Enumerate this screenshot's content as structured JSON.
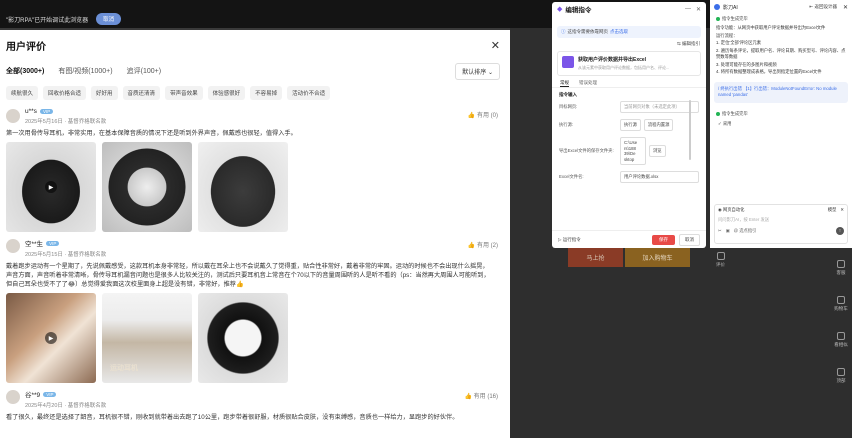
{
  "background": {
    "banner_text": "\"影刀RPA\"已开始调试此浏览器",
    "cancel_label": "取消",
    "add_cart": "加入购物车",
    "buy_now": "马上抢",
    "comment": "评价",
    "side_icons": [
      "客服",
      "购物车",
      "看相似",
      "顶部"
    ]
  },
  "reviews": {
    "title": "用户评价",
    "close_icon": "close-icon",
    "filters": [
      {
        "label": "全部(3000+)",
        "active": true
      },
      {
        "label": "有图/视频(1000+)",
        "active": false
      },
      {
        "label": "追评(100+)",
        "active": false
      }
    ],
    "sort_label": "默认排序 ⌄",
    "tags": [
      "续航很久",
      "回收价格合适",
      "好好用",
      "音质还清清",
      "带声音效果",
      "体验感很好",
      "不容易掉",
      "活动价不合适"
    ],
    "items": [
      {
        "name": "u**s",
        "vip": "VIP",
        "meta": "2025年5月16日 · 基督乔格联名款",
        "useful": "有用 (0)",
        "text": "第一次用骨传导耳机，非常实用，在基本保障音质的情况下还是听到外界声音，佩戴感也很轻，值得入手。"
      },
      {
        "name": "空**生",
        "vip": "VIP",
        "meta": "2025年5月15日 · 基督乔格联名款",
        "useful": "有用 (2)",
        "text": "戴着跑步运动有一个星期了，先说佩戴感受，这款耳机本身非常轻，所以戴在耳朵上也不会说戴久了觉得重，贴合性非常好，戴着非常的牢固。运动的时候也不会出现什么摇晃，声音方面，声音听着非常清晰，骨传导耳机漏音问题也是很多人比较关注的，测试后只要耳机音上常音在个70以下的音量周围听的人是听不看的（ps：当然再大周围人可能听到，但自己耳朵也受不了了😂）总觉得爱我面这次校里面身上超是没有错，非常好，推荐👍",
        "box_label": "运动耳机"
      },
      {
        "name": "谷**9",
        "vip": "VIP",
        "meta": "2025年4月20日 · 基督乔格联名款",
        "useful": "有用 (16)",
        "text": "看了很久，最终还是选择了韶音，耳机很不错，刚收到就带着出去跑了10公里，跑步带着很舒服，材质很贴合皮肤，没有束缚感，音质也一样给力，显跑步的好伙伴。"
      }
    ]
  },
  "edit_panel": {
    "title": "编辑指令",
    "tip_text": "这指令需要依靠网页",
    "tip_link": "点击选取",
    "edit_link": "编辑指引",
    "card_title": "获取用户评价数据并导出Excel",
    "card_sub": "从该元素中获取用户评论数据，包括用户名、评论...",
    "tabs": [
      "常规",
      "错误处理"
    ],
    "section": "指令输入",
    "rows": [
      {
        "label": "目标网页:",
        "value": "当前网页对象（未选定此项）"
      },
      {
        "label": "执行源:",
        "chip1": "执行源",
        "chip2": "流程内置源"
      },
      {
        "label": "导出Excel文件的保存文件夹:",
        "path": "C:\\Use rs\\188 39\\De sktop",
        "chip": "浏览"
      },
      {
        "label": "Excel文件名:",
        "value": "用户评论数据.xlsx"
      }
    ],
    "footer_run": "运行指令",
    "save": "保存",
    "cancel": "取消"
  },
  "ai_panel": {
    "title": "影刀AI",
    "back": "返回设计器",
    "status_done": "指令生成完毕",
    "msg": "指令功能：从网页中获取用户评论数据并导出为Excel文件",
    "steps_title": "运行流程：",
    "steps": [
      "1. 定位'全部'评论区元素",
      "2. 遍历每条评论，提取用户名、评论日期、购买型号、评论内容、点赞数等数据",
      "3. 处理可能存在的多图片和视频",
      "4. 将所有数据整理成表格，导出到指定位置的Excel文件"
    ],
    "error_text": "/ 终执行出错 【1】行出错：ModuleNotFoundError: No module named 'pandas'",
    "status_done2": "指令生成完毕",
    "apply": "采用",
    "input_title": "网页自动化",
    "input_mode": "模型",
    "input_placeholder": "问问影刀AI，按 Enter 发送",
    "input_foot": "@ 选点指引"
  }
}
